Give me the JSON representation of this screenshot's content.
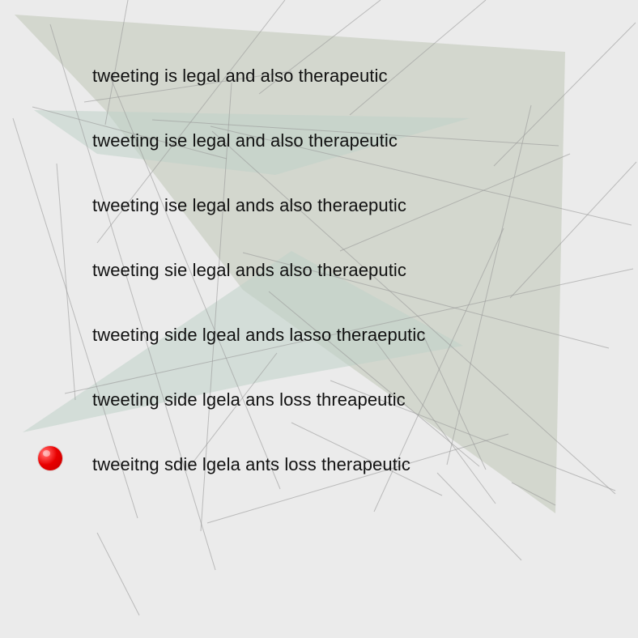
{
  "colors": {
    "background": "#ebebeb",
    "text": "#111111",
    "marker": "#e80000",
    "panel_fill": "#c8cdbf",
    "accent_fill": "#bfd1c8",
    "line_color": "#9a9a9a"
  },
  "lines": [
    "tweeting is legal and also therapeutic",
    "tweeting ise legal and also therapeutic",
    "tweeting ise legal ands also theraeputic",
    "tweeting sie legal ands also theraeputic",
    "tweeting side lgeal ands lasso theraeputic",
    "tweeting side lgela ans loss threapeutic",
    "tweeitng sdie lgela ants loss therapeutic"
  ],
  "marker": {
    "icon": "red-ball-icon",
    "line_index": 6
  }
}
